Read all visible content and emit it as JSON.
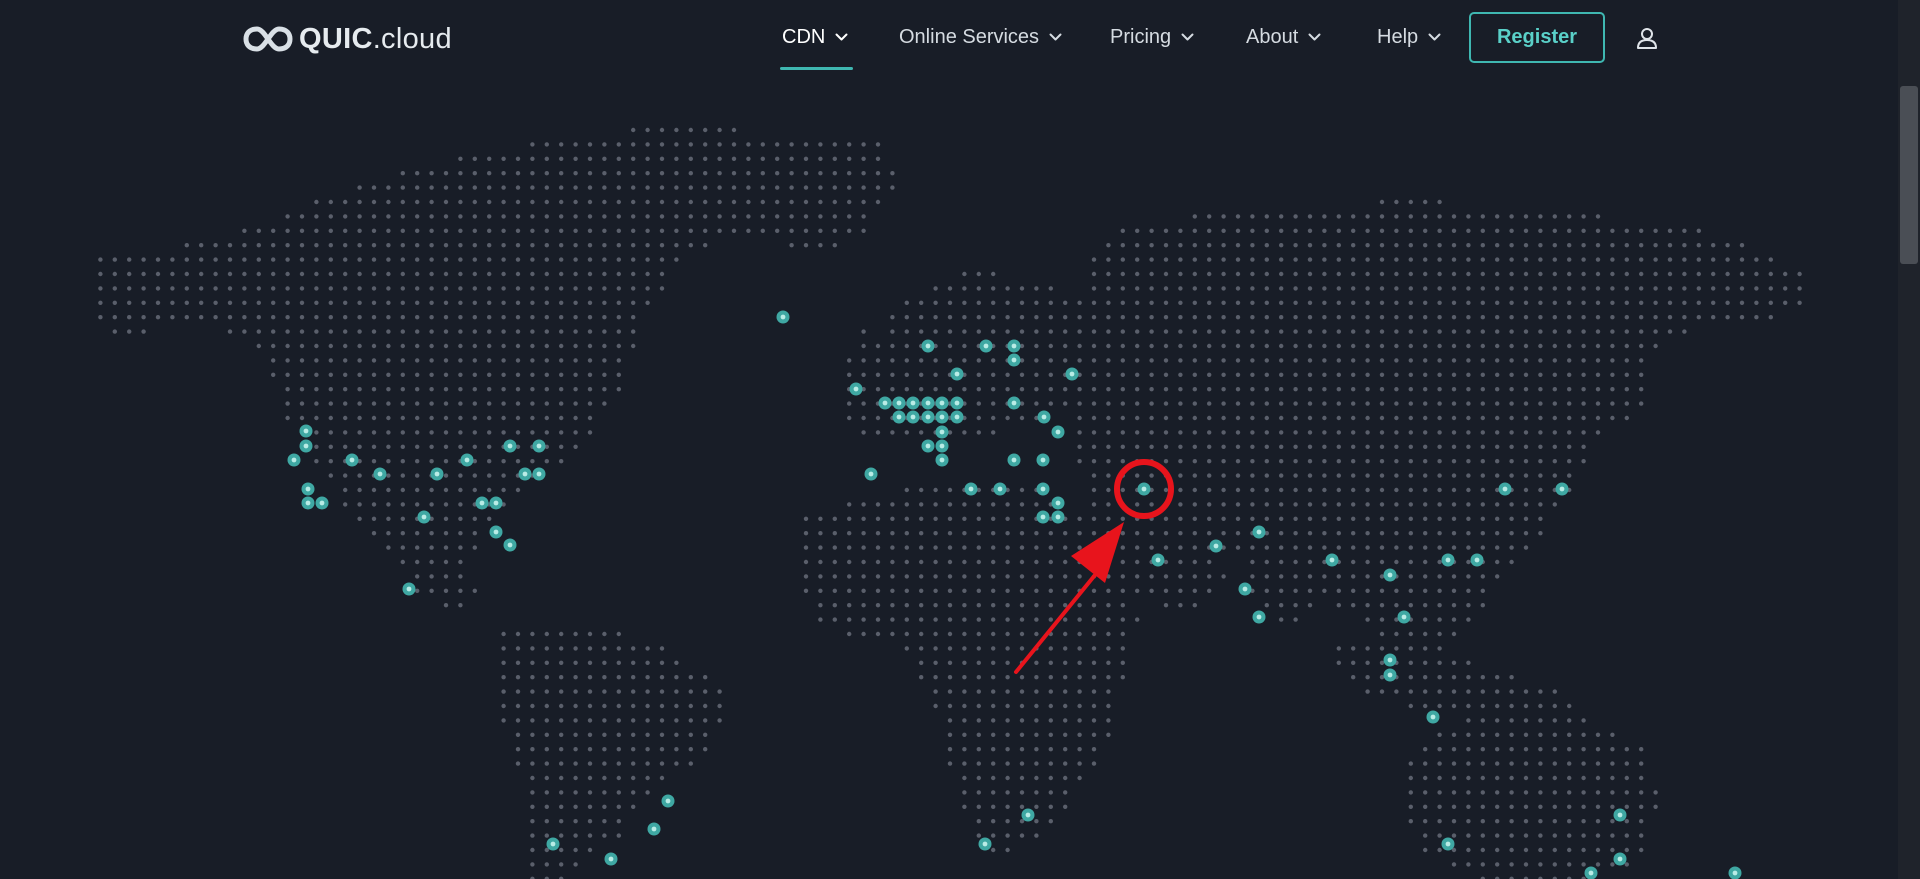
{
  "logo": {
    "brand": "QUIC",
    "tld": ".cloud"
  },
  "nav": {
    "items": [
      {
        "label": "CDN",
        "active": true
      },
      {
        "label": "Online Services",
        "active": false
      },
      {
        "label": "Pricing",
        "active": false
      },
      {
        "label": "About",
        "active": false
      },
      {
        "label": "Help",
        "active": false
      }
    ],
    "register_label": "Register"
  },
  "colors": {
    "background": "#181d27",
    "dot": "#5a5f6b",
    "pop_fill": "#3fa8a3",
    "accent": "#3fb7b1",
    "annotation": "#e8141c"
  },
  "icons": {
    "logo": "infinity-loop-icon",
    "dropdown": "chevron-down-icon",
    "account": "user-icon"
  },
  "annotation": {
    "type": "red circle with arrow",
    "target": "highlighted point-of-presence location"
  }
}
